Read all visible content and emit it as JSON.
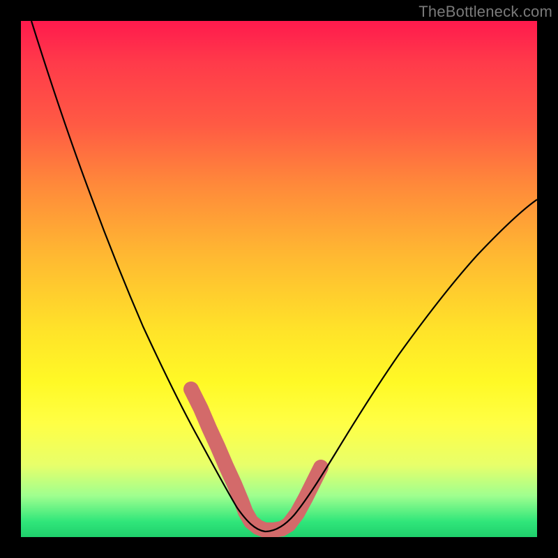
{
  "watermark": "TheBottleneck.com",
  "chart_data": {
    "type": "line",
    "title": "",
    "xlabel": "",
    "ylabel": "",
    "xlim": [
      0,
      100
    ],
    "ylim": [
      0,
      100
    ],
    "series": [
      {
        "name": "bottleneck-curve",
        "x": [
          2,
          6,
          10,
          14,
          18,
          22,
          26,
          30,
          33.5,
          36,
          38,
          40,
          42,
          43.5,
          45,
          46.5,
          48,
          50,
          53,
          56,
          60,
          65,
          70,
          75,
          80,
          85,
          90,
          95,
          100
        ],
        "y": [
          100,
          90,
          80,
          70,
          61,
          52,
          44,
          36,
          29,
          23,
          18,
          13,
          9,
          6,
          3.5,
          2,
          1.5,
          1.5,
          3,
          6,
          11,
          18,
          25,
          32,
          39,
          46,
          53,
          59,
          65
        ]
      }
    ],
    "marker_regions": [
      {
        "name": "left-descent-pink",
        "x_range": [
          33,
          44
        ],
        "y_range": [
          6,
          28
        ]
      },
      {
        "name": "valley-pink",
        "x_range": [
          44,
          52
        ],
        "y_range": [
          1,
          4
        ]
      },
      {
        "name": "right-ascent-pink",
        "x_range": [
          52,
          58
        ],
        "y_range": [
          4,
          14
        ]
      }
    ],
    "colors": {
      "curve": "#000000",
      "marker": "#d36a6a",
      "bg_top": "#ff1a4d",
      "bg_bottom": "#1fd06c"
    }
  }
}
